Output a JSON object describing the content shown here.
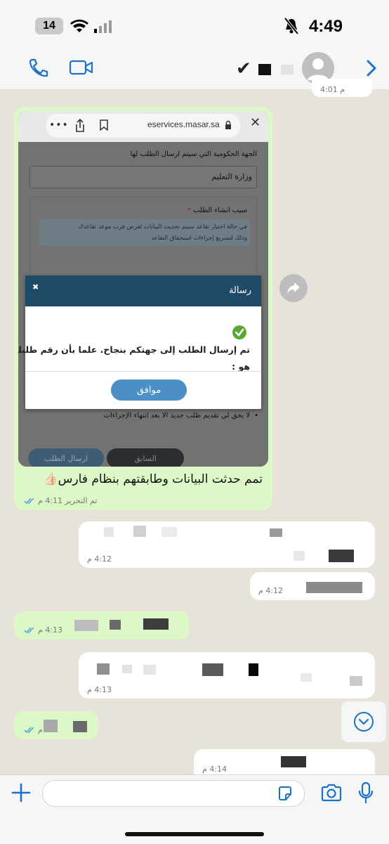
{
  "status": {
    "time": "4:49",
    "battery": "14"
  },
  "nav": {
    "name": "✔"
  },
  "chat": {
    "top_partial_time": "4:01 م",
    "image_message": {
      "browser_url": "eservices.masar.sa",
      "field_label": "الجهة الحكومية التي سيتم ارسال الطلب لها",
      "field_value": "وزارة التعليم",
      "reason_label": "سبب انشاء الطلب",
      "required_mark": "*",
      "info_text_line1": "في حالة اختيار تقاعد سيتم تحديث البيانات لعرض قرب موعد تقاعدك",
      "info_text_line2": "وذلك لتسريع إجراءات استحقاق التقاعد",
      "dialog_title": "رسالة",
      "dialog_close": "✖",
      "dialog_message_line1": "تم إرسال الطلب إلى جهتكم بنجاح. علما بأن رقم طلبك",
      "dialog_message_line2": "هو :",
      "dialog_ok": "موافق",
      "bullet_text": "لا يحق لي تقديم طلب جديد الا بعد انتهاء الإجراءات",
      "prev_button": "السابق",
      "submit_button": "ارسال الطلب"
    },
    "caption": "تمم حدثت البيانات وطابقتهم بنظام فارس👍🏻",
    "caption_meta": "تم التحرير 4:11 م",
    "times": {
      "in1": "4:12 م",
      "in2": "4:12 م",
      "out1": "4:13 م",
      "in3": "4:13 م",
      "out2": "م",
      "in4": "4:14 م"
    }
  },
  "colors": {
    "outgoing": "#dcf8c6",
    "incoming": "#ffffff",
    "accent": "#007aff",
    "dialog_header": "#1f4b69"
  }
}
